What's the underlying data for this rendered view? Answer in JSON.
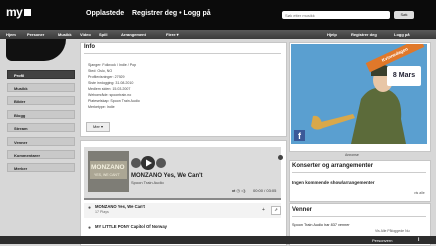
{
  "topbar": {
    "logo": "my",
    "nav_upload": "Opplastede",
    "nav_register": "Registrer deg • Logg på",
    "search_placeholder": "Søk etter musikk",
    "search_button": "Søk"
  },
  "navbar": {
    "left_items": [
      "Hjem",
      "Personer",
      "Musikk",
      "Video",
      "Spill",
      "Arrangement",
      "Flere ▾"
    ],
    "right_items": [
      "Hjelp",
      "Registrer deg",
      "Logg på"
    ]
  },
  "sidebar": {
    "items": [
      "Profil",
      "Musikk",
      "Bilder",
      "Blogg",
      "Stream",
      "Venner",
      "Kommentarer",
      "Merker"
    ]
  },
  "info": {
    "heading": "Info",
    "lines": [
      "Sjanger: Folkrock / Indie / Pop",
      "Sted: Oslo, NO",
      "Profilevisninger: 27929",
      "Siste innlogging: 31.08.2010",
      "Medlem siden: 15.03.2007",
      "Webområde: spoontrain.no",
      "Plateselskap: Spoon Train Audio",
      "Merketype: Indie"
    ],
    "more_button": "Mer ▾"
  },
  "player": {
    "cover_text": "MONZANO",
    "cover_subtext": "YES, WE CAN'T",
    "track_title": "MONZANO Yes, We Can't",
    "artist": "Spoon Train Audio",
    "time": "00:00 / 03:05",
    "tracks": [
      {
        "title": "MONZANO Yes, We Can't",
        "plays": "17 Plays"
      },
      {
        "title": "MY LITTLE PONY Capitol Of Norway",
        "plays": ""
      }
    ]
  },
  "ad": {
    "ribbon": "Kvinnedagen",
    "logo_text": "8 Mars",
    "label": "Annonse",
    "facebook": "f"
  },
  "konsert": {
    "heading": "Konserter og arrangementer",
    "text": "Ingen kommende show/arrangementer",
    "link": "vis alle"
  },
  "venner": {
    "heading": "Venner",
    "text": "Spoon Train Audio har 837 venner",
    "link": "Vis  Alle  Påloggede  Nu"
  },
  "bottombar": {
    "people": "Personvern",
    "info_icon": "i"
  },
  "colors": {
    "topbar": "#0b0b0b",
    "active_sidebar": "#424242",
    "ad_sky": "#5a9fd0",
    "ribbon": "#e0782a"
  }
}
